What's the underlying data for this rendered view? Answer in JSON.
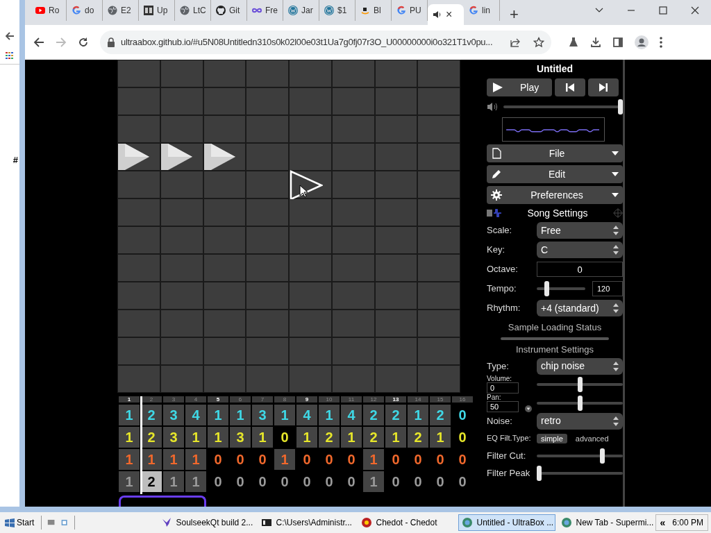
{
  "background_window": {
    "text": "#"
  },
  "browser": {
    "tabs": [
      {
        "label": "Ro",
        "kind": "youtube",
        "selected": false
      },
      {
        "label": "do",
        "kind": "google",
        "selected": false
      },
      {
        "label": "E2",
        "kind": "globe",
        "selected": false
      },
      {
        "label": "Up",
        "kind": "square",
        "selected": false
      },
      {
        "label": "LtC",
        "kind": "globe",
        "selected": false
      },
      {
        "label": "Git",
        "kind": "github",
        "selected": false
      },
      {
        "label": "Fre",
        "kind": "infinity",
        "selected": false
      },
      {
        "label": "Jar",
        "kind": "wordpress",
        "selected": false
      },
      {
        "label": "$1",
        "kind": "wordpress",
        "selected": false
      },
      {
        "label": "Bl",
        "kind": "amazon",
        "selected": false
      },
      {
        "label": "PU",
        "kind": "google",
        "selected": false
      },
      {
        "close": "×",
        "kind": "speaker",
        "selected": true
      },
      {
        "label": "lin",
        "kind": "google",
        "selected": false
      }
    ],
    "new_tab": "+",
    "forward_disabled": true,
    "url": "ultraabox.github.io/#u5N08Untitledn310s0k02l00e03t1Ua7g0fj07r3O_U00000000i0o321T1v0pu..."
  },
  "pattern_grid": {
    "rows": [
      [
        {
          "kind": "empty"
        },
        {
          "kind": "empty"
        },
        {
          "kind": "empty"
        },
        {
          "kind": "empty"
        },
        {
          "kind": "empty"
        },
        {
          "kind": "empty"
        },
        {
          "kind": "empty"
        },
        {
          "kind": "empty"
        }
      ],
      [
        {
          "kind": "empty"
        },
        {
          "kind": "empty"
        },
        {
          "kind": "empty"
        },
        {
          "kind": "empty"
        },
        {
          "kind": "empty"
        },
        {
          "kind": "empty"
        },
        {
          "kind": "empty"
        },
        {
          "kind": "empty"
        }
      ],
      [
        {
          "kind": "empty"
        },
        {
          "kind": "empty"
        },
        {
          "kind": "empty"
        },
        {
          "kind": "empty"
        },
        {
          "kind": "empty"
        },
        {
          "kind": "empty"
        },
        {
          "kind": "empty"
        },
        {
          "kind": "empty"
        }
      ],
      [
        {
          "kind": "note"
        },
        {
          "kind": "note"
        },
        {
          "kind": "note"
        },
        {
          "kind": "empty"
        },
        {
          "kind": "empty"
        },
        {
          "kind": "empty"
        },
        {
          "kind": "empty"
        },
        {
          "kind": "empty"
        }
      ],
      [
        {
          "kind": "empty"
        },
        {
          "kind": "empty"
        },
        {
          "kind": "empty"
        },
        {
          "kind": "empty"
        },
        {
          "kind": "preview"
        },
        {
          "kind": "empty"
        },
        {
          "kind": "empty"
        },
        {
          "kind": "empty"
        }
      ],
      [
        {
          "kind": "empty"
        },
        {
          "kind": "empty"
        },
        {
          "kind": "empty"
        },
        {
          "kind": "empty"
        },
        {
          "kind": "empty"
        },
        {
          "kind": "empty"
        },
        {
          "kind": "empty"
        },
        {
          "kind": "empty"
        }
      ],
      [
        {
          "kind": "empty"
        },
        {
          "kind": "empty"
        },
        {
          "kind": "empty"
        },
        {
          "kind": "empty"
        },
        {
          "kind": "empty"
        },
        {
          "kind": "empty"
        },
        {
          "kind": "empty"
        },
        {
          "kind": "empty"
        }
      ],
      [
        {
          "kind": "empty"
        },
        {
          "kind": "empty"
        },
        {
          "kind": "empty"
        },
        {
          "kind": "empty"
        },
        {
          "kind": "empty"
        },
        {
          "kind": "empty"
        },
        {
          "kind": "empty"
        },
        {
          "kind": "empty"
        }
      ],
      [
        {
          "kind": "empty"
        },
        {
          "kind": "empty"
        },
        {
          "kind": "empty"
        },
        {
          "kind": "empty"
        },
        {
          "kind": "empty"
        },
        {
          "kind": "empty"
        },
        {
          "kind": "empty"
        },
        {
          "kind": "empty"
        }
      ],
      [
        {
          "kind": "empty"
        },
        {
          "kind": "empty"
        },
        {
          "kind": "empty"
        },
        {
          "kind": "empty"
        },
        {
          "kind": "empty"
        },
        {
          "kind": "empty"
        },
        {
          "kind": "empty"
        },
        {
          "kind": "empty"
        }
      ],
      [
        {
          "kind": "empty"
        },
        {
          "kind": "empty"
        },
        {
          "kind": "empty"
        },
        {
          "kind": "empty"
        },
        {
          "kind": "empty"
        },
        {
          "kind": "empty"
        },
        {
          "kind": "empty"
        },
        {
          "kind": "empty"
        }
      ],
      [
        {
          "kind": "empty"
        },
        {
          "kind": "empty"
        },
        {
          "kind": "empty"
        },
        {
          "kind": "empty"
        },
        {
          "kind": "empty"
        },
        {
          "kind": "empty"
        },
        {
          "kind": "empty"
        },
        {
          "kind": "empty"
        }
      ]
    ]
  },
  "track": {
    "playhead": {
      "level": 0.0625
    },
    "bars": [
      {
        "label": "1",
        "emphasized": true
      },
      {
        "label": "2",
        "emphasized": false
      },
      {
        "label": "3",
        "emphasized": false
      },
      {
        "label": "4",
        "emphasized": false
      },
      {
        "label": "5",
        "emphasized": true
      },
      {
        "label": "6",
        "emphasized": false
      },
      {
        "label": "7",
        "emphasized": false
      },
      {
        "label": "8",
        "emphasized": false
      },
      {
        "label": "9",
        "emphasized": true
      },
      {
        "label": "10",
        "emphasized": false
      },
      {
        "label": "11",
        "emphasized": false
      },
      {
        "label": "12",
        "emphasized": false
      },
      {
        "label": "13",
        "emphasized": true
      },
      {
        "label": "14",
        "emphasized": false
      },
      {
        "label": "15",
        "emphasized": false
      },
      {
        "label": "16",
        "emphasized": false
      }
    ],
    "channels": [
      {
        "color": "#3fd8e6",
        "cells": [
          {
            "text": "1",
            "filled": true,
            "selected": false
          },
          {
            "text": "2",
            "filled": true,
            "selected": false
          },
          {
            "text": "3",
            "filled": true,
            "selected": false
          },
          {
            "text": "4",
            "filled": true,
            "selected": false
          },
          {
            "text": "1",
            "filled": true,
            "selected": false
          },
          {
            "text": "1",
            "filled": true,
            "selected": false
          },
          {
            "text": "3",
            "filled": true,
            "selected": false
          },
          {
            "text": "1",
            "filled": true,
            "selected": false
          },
          {
            "text": "4",
            "filled": true,
            "selected": false
          },
          {
            "text": "1",
            "filled": true,
            "selected": false
          },
          {
            "text": "4",
            "filled": true,
            "selected": false
          },
          {
            "text": "2",
            "filled": true,
            "selected": false
          },
          {
            "text": "2",
            "filled": true,
            "selected": false
          },
          {
            "text": "1",
            "filled": true,
            "selected": false
          },
          {
            "text": "2",
            "filled": true,
            "selected": false
          },
          {
            "text": "0",
            "filled": false,
            "selected": false
          }
        ]
      },
      {
        "color": "#e6e62a",
        "cells": [
          {
            "text": "1",
            "filled": true,
            "selected": false
          },
          {
            "text": "2",
            "filled": true,
            "selected": false
          },
          {
            "text": "3",
            "filled": true,
            "selected": false
          },
          {
            "text": "1",
            "filled": true,
            "selected": false
          },
          {
            "text": "1",
            "filled": true,
            "selected": false
          },
          {
            "text": "3",
            "filled": true,
            "selected": false
          },
          {
            "text": "1",
            "filled": true,
            "selected": false
          },
          {
            "text": "0",
            "filled": false,
            "selected": false
          },
          {
            "text": "1",
            "filled": true,
            "selected": false
          },
          {
            "text": "2",
            "filled": true,
            "selected": false
          },
          {
            "text": "1",
            "filled": true,
            "selected": false
          },
          {
            "text": "2",
            "filled": true,
            "selected": false
          },
          {
            "text": "1",
            "filled": true,
            "selected": false
          },
          {
            "text": "2",
            "filled": true,
            "selected": false
          },
          {
            "text": "1",
            "filled": true,
            "selected": false
          },
          {
            "text": "0",
            "filled": false,
            "selected": false
          }
        ]
      },
      {
        "color": "#f0682c",
        "cells": [
          {
            "text": "1",
            "filled": true,
            "selected": false
          },
          {
            "text": "1",
            "filled": true,
            "selected": false
          },
          {
            "text": "1",
            "filled": true,
            "selected": false
          },
          {
            "text": "1",
            "filled": true,
            "selected": false
          },
          {
            "text": "0",
            "filled": false,
            "selected": false
          },
          {
            "text": "0",
            "filled": false,
            "selected": false
          },
          {
            "text": "0",
            "filled": false,
            "selected": false
          },
          {
            "text": "1",
            "filled": true,
            "selected": false
          },
          {
            "text": "0",
            "filled": false,
            "selected": false
          },
          {
            "text": "0",
            "filled": false,
            "selected": false
          },
          {
            "text": "0",
            "filled": false,
            "selected": false
          },
          {
            "text": "1",
            "filled": true,
            "selected": false
          },
          {
            "text": "0",
            "filled": false,
            "selected": false
          },
          {
            "text": "0",
            "filled": false,
            "selected": false
          },
          {
            "text": "0",
            "filled": false,
            "selected": false
          },
          {
            "text": "0",
            "filled": false,
            "selected": false
          }
        ]
      },
      {
        "color": "#9a9a9a",
        "cells": [
          {
            "text": "1",
            "filled": true,
            "selected": false
          },
          {
            "text": "2",
            "filled": true,
            "selected": true
          },
          {
            "text": "1",
            "filled": true,
            "selected": false
          },
          {
            "text": "1",
            "filled": true,
            "selected": false
          },
          {
            "text": "0",
            "filled": false,
            "selected": false
          },
          {
            "text": "0",
            "filled": false,
            "selected": false
          },
          {
            "text": "0",
            "filled": false,
            "selected": false
          },
          {
            "text": "0",
            "filled": false,
            "selected": false
          },
          {
            "text": "0",
            "filled": false,
            "selected": false
          },
          {
            "text": "0",
            "filled": false,
            "selected": false
          },
          {
            "text": "0",
            "filled": false,
            "selected": false
          },
          {
            "text": "1",
            "filled": true,
            "selected": false
          },
          {
            "text": "0",
            "filled": false,
            "selected": false
          },
          {
            "text": "0",
            "filled": false,
            "selected": false
          },
          {
            "text": "0",
            "filled": false,
            "selected": false
          },
          {
            "text": "0",
            "filled": false,
            "selected": false
          }
        ]
      }
    ]
  },
  "panel": {
    "title": "Untitled",
    "play": "Play",
    "volume": {
      "level": 1.0
    },
    "menus": [
      {
        "label": "File",
        "kind": "file"
      },
      {
        "label": "Edit",
        "kind": "pencil"
      },
      {
        "label": "Preferences",
        "kind": "gear"
      }
    ],
    "song_settings": {
      "title": "Song Settings",
      "rows": [
        {
          "kind": "select",
          "label": "Scale:",
          "value": "Free"
        },
        {
          "kind": "select",
          "label": "Key:",
          "value": "C"
        },
        {
          "kind": "number",
          "label": "Octave:",
          "value": "0"
        },
        {
          "kind": "slider_number",
          "label": "Tempo:",
          "level": 0.18,
          "value": "120"
        },
        {
          "kind": "select",
          "label": "Rhythm:",
          "value": "+4 (standard)"
        }
      ]
    },
    "sample_status": "Sample Loading Status",
    "instrument_settings": {
      "title": "Instrument Settings",
      "rows": [
        {
          "kind": "select",
          "label": "Type:",
          "value": "chip noise"
        },
        {
          "kind": "stacked_slider",
          "label": "Volume:",
          "value": "0",
          "level": 0.5,
          "expander": false
        },
        {
          "kind": "stacked_slider",
          "label": "Pan:",
          "value": "50",
          "level": 0.5,
          "expander": true
        },
        {
          "kind": "select",
          "label": "Noise:",
          "value": "retro"
        },
        {
          "kind": "choice",
          "label": "EQ Filt.Type:",
          "options": [
            {
              "label": "simple",
              "selected": true
            },
            {
              "label": "advanced",
              "selected": false
            }
          ]
        },
        {
          "kind": "slider",
          "label": "Filter Cut:",
          "level": 0.78
        },
        {
          "kind": "slider",
          "label": "Filter Peak",
          "level": 0.0
        }
      ]
    }
  },
  "taskbar": {
    "start": "Start",
    "tasks": [
      {
        "label": "SoulseekQt build 2...",
        "kind": "bird",
        "selected": false
      },
      {
        "label": "C:\\Users\\Administr...",
        "kind": "archive",
        "selected": false
      },
      {
        "label": "Chedot - Chedot",
        "kind": "ball",
        "selected": false
      },
      {
        "label": "Untitled - UltraBox ...",
        "kind": "browser",
        "selected": true
      },
      {
        "label": "New Tab - Supermi...",
        "kind": "browser",
        "selected": false
      }
    ],
    "tray_toggle": "«",
    "clock": "6:00 PM"
  }
}
